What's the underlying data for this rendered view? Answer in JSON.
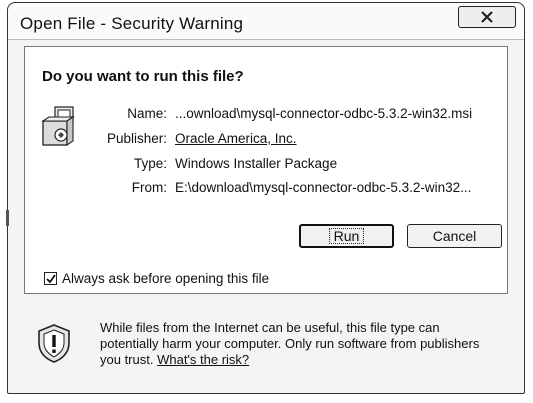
{
  "window": {
    "title": "Open File - Security Warning",
    "close_icon": "close-icon"
  },
  "dialog": {
    "question": "Do you want to run this file?",
    "file_icon": "installer-package-icon",
    "details": {
      "name_label": "Name:",
      "name_value": "...ownload\\mysql-connector-odbc-5.3.2-win32.msi",
      "publisher_label": "Publisher:",
      "publisher_value": "Oracle America, Inc.",
      "type_label": "Type:",
      "type_value": "Windows Installer Package",
      "from_label": "From:",
      "from_value": "E:\\download\\mysql-connector-odbc-5.3.2-win32..."
    },
    "buttons": {
      "run_label": "Run",
      "cancel_label": "Cancel"
    },
    "checkbox": {
      "label": "Always ask before opening this file",
      "checked": true
    }
  },
  "warning": {
    "icon": "shield-warning-icon",
    "text": "While files from the Internet can be useful, this file type can potentially harm your computer. Only run software from publishers you trust.",
    "link_label": "What's the risk?"
  },
  "colors": {
    "window_bg": "#f4f4f4",
    "panel_bg": "#ffffff",
    "border": "#333333"
  }
}
